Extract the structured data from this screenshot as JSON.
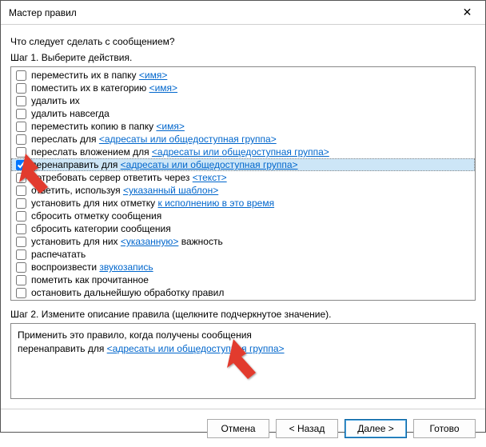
{
  "title": "Мастер правил",
  "prompt": "Что следует сделать с сообщением?",
  "step1_label": "Шаг 1. Выберите действия.",
  "actions": [
    {
      "checked": false,
      "selected": false,
      "pre": "переместить их в папку ",
      "link": "<имя>",
      "post": ""
    },
    {
      "checked": false,
      "selected": false,
      "pre": "поместить их в категорию ",
      "link": "<имя>",
      "post": ""
    },
    {
      "checked": false,
      "selected": false,
      "pre": "удалить их",
      "link": "",
      "post": ""
    },
    {
      "checked": false,
      "selected": false,
      "pre": "удалить навсегда",
      "link": "",
      "post": ""
    },
    {
      "checked": false,
      "selected": false,
      "pre": "переместить копию в папку ",
      "link": "<имя>",
      "post": ""
    },
    {
      "checked": false,
      "selected": false,
      "pre": "переслать для ",
      "link": "<адресаты или общедоступная группа>",
      "post": ""
    },
    {
      "checked": false,
      "selected": false,
      "pre": "переслать вложением для ",
      "link": "<адресаты или общедоступная группа>",
      "post": ""
    },
    {
      "checked": true,
      "selected": true,
      "pre": "перенаправить для ",
      "link": "<адресаты или общедоступная группа>",
      "post": ""
    },
    {
      "checked": false,
      "selected": false,
      "pre": "потребовать сервер ответить через ",
      "link": "<текст>",
      "post": ""
    },
    {
      "checked": false,
      "selected": false,
      "pre": "ответить, используя ",
      "link": "<указанный шаблон>",
      "post": ""
    },
    {
      "checked": false,
      "selected": false,
      "pre": "установить для них отметку ",
      "link": "к исполнению в это время",
      "post": ""
    },
    {
      "checked": false,
      "selected": false,
      "pre": "сбросить отметку сообщения",
      "link": "",
      "post": ""
    },
    {
      "checked": false,
      "selected": false,
      "pre": "сбросить категории сообщения",
      "link": "",
      "post": ""
    },
    {
      "checked": false,
      "selected": false,
      "pre": "установить для них ",
      "link": "<указанную>",
      "post": " важность"
    },
    {
      "checked": false,
      "selected": false,
      "pre": "распечатать",
      "link": "",
      "post": ""
    },
    {
      "checked": false,
      "selected": false,
      "pre": "воспроизвести ",
      "link": "звукозапись",
      "post": ""
    },
    {
      "checked": false,
      "selected": false,
      "pre": "пометить как прочитанное",
      "link": "",
      "post": ""
    },
    {
      "checked": false,
      "selected": false,
      "pre": "остановить дальнейшую обработку правил",
      "link": "",
      "post": ""
    }
  ],
  "step2_label": "Шаг 2. Измените описание правила (щелкните подчеркнутое значение).",
  "description": {
    "line1": "Применить это правило, когда получены сообщения",
    "line2_pre": "перенаправить для ",
    "line2_link": "<адресаты или общедоступная группа>"
  },
  "buttons": {
    "cancel": "Отмена",
    "back": "< Назад",
    "next": "Далее >",
    "finish": "Готово"
  },
  "annotation_color": "#e23b2f"
}
